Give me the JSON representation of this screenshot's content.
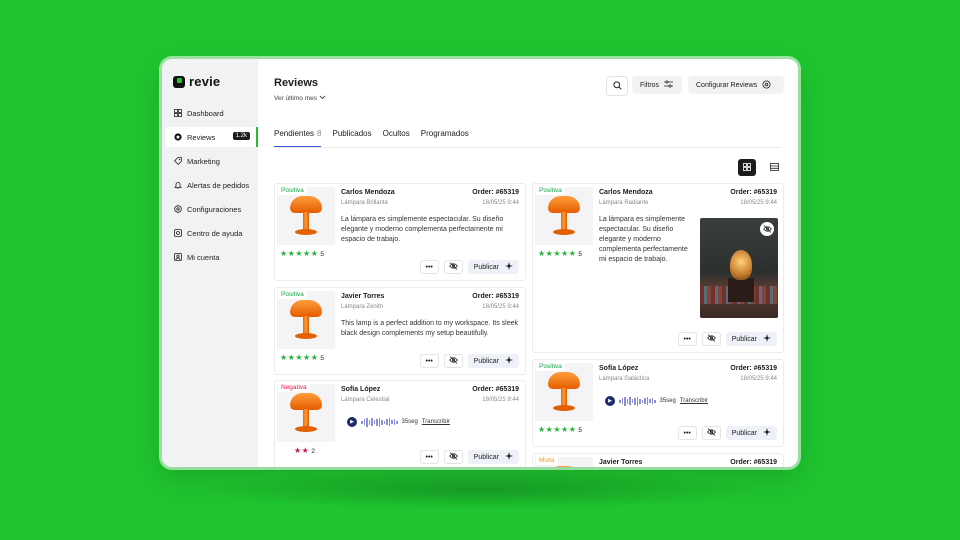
{
  "app": {
    "name": "revie"
  },
  "sidebar": {
    "items": [
      {
        "label": "Dashboard",
        "icon": "dashboard-icon"
      },
      {
        "label": "Reviews",
        "icon": "reviews-icon",
        "badge": "1.2k",
        "active": true
      },
      {
        "label": "Marketing",
        "icon": "tag-icon"
      },
      {
        "label": "Alertas de pedidos",
        "icon": "bell-icon"
      },
      {
        "label": "Configuraciones",
        "icon": "gear-icon"
      },
      {
        "label": "Centro de ayuda",
        "icon": "help-icon"
      },
      {
        "label": "Mi cuenta",
        "icon": "user-icon"
      }
    ]
  },
  "header": {
    "title": "Reviews",
    "period": "Ver último mes",
    "filters_label": "Filtros",
    "configure_label": "Configurar Reviews"
  },
  "tabs": [
    {
      "label": "Pendientes",
      "count": "8",
      "active": true
    },
    {
      "label": "Publicados"
    },
    {
      "label": "Ocultos"
    },
    {
      "label": "Programados"
    }
  ],
  "actions": {
    "publish_label": "Publicar"
  },
  "reviews_left": [
    {
      "sentiment": "Positiva",
      "author": "Carlos Mendoza",
      "product": "Lámpara Brillante",
      "order": "Order: #65319",
      "date": "18/05/25 9:44",
      "text": "La lámpara es simplemente espectacular. Su diseño elegante y moderno complementa perfectamente mi espacio de trabajo.",
      "stars": 5,
      "rating": "5"
    },
    {
      "sentiment": "Positiva",
      "author": "Javier Torres",
      "product": "Lámpara Zenith",
      "order": "Order: #65319",
      "date": "18/05/25 9:44",
      "text": "This lamp is a perfect addition to my workspace. Its sleek black design complements my setup beautifully.",
      "stars": 5,
      "rating": "5"
    },
    {
      "sentiment": "Negativa",
      "author": "Sofía López",
      "product": "Lámpara Celestial",
      "order": "Order: #65319",
      "date": "18/05/25 9:44",
      "audio_duration": "35seg",
      "audio_action": "Transcribir",
      "stars": 2,
      "rating": "2"
    }
  ],
  "reviews_right": [
    {
      "sentiment": "Positiva",
      "author": "Carlos Mendoza",
      "product": "Lámpara Radiante",
      "order": "Order: #65319",
      "date": "18/05/25 9:44",
      "text": "La lámpara es simplemente espectacular. Su diseño elegante y moderno complementa perfectamente mi espacio de trabajo.",
      "stars": 5,
      "rating": "5"
    },
    {
      "sentiment": "Positiva",
      "author": "Sofía López",
      "product": "Lámpara Galáctica",
      "order": "Order: #65319",
      "date": "18/05/25 9:44",
      "audio_duration": "35seg",
      "audio_action": "Transcribir",
      "stars": 5,
      "rating": "5"
    },
    {
      "sentiment": "Mixta",
      "author": "Javier Torres",
      "order": "Order: #65319"
    }
  ],
  "colors": {
    "accent": "#1fc42f",
    "tab_underline": "#3f57d8",
    "positive": "#16a34a",
    "negative": "#e11d48",
    "mixed": "#f59e0b"
  }
}
